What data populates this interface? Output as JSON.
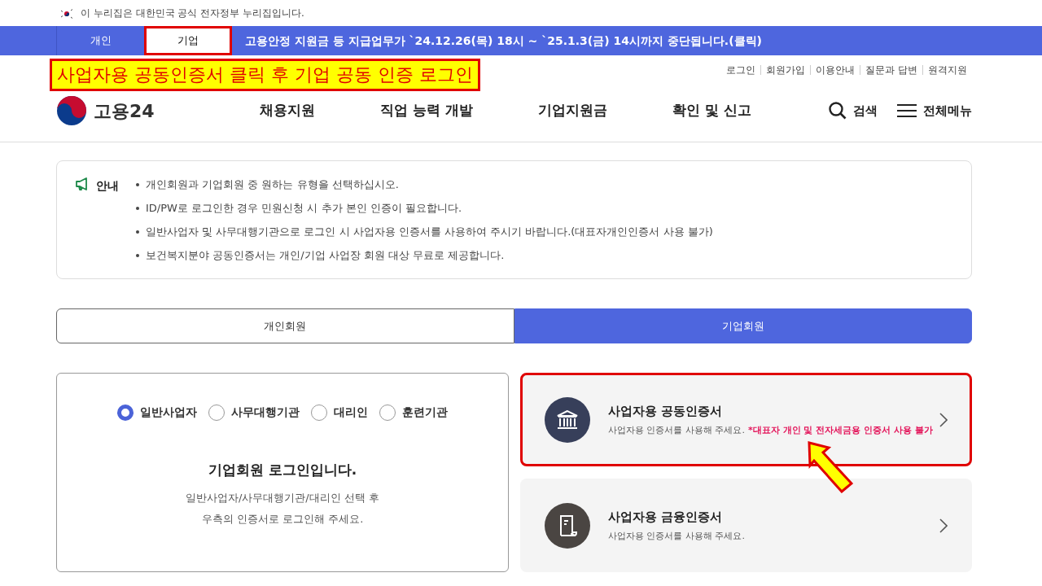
{
  "gov_banner": {
    "text": "이 누리집은 대한민국 공식 전자정부 누리집입니다."
  },
  "top_tabs": [
    {
      "label": "개인",
      "selected": false,
      "highlighted": false
    },
    {
      "label": "기업",
      "selected": true,
      "highlighted": true
    }
  ],
  "notice_ticker": "고용안정 지원금 등 지급업무가 `24.12.26(목) 18시 ~ `25.1.3(금) 14시까지 중단됩니다.(클릭)",
  "annotation": {
    "text": "사업자용 공동인증서 클릭 후 기업 공동 인증 로그인"
  },
  "utility_links": [
    "로그인",
    "회원가입",
    "이용안내",
    "질문과 답변",
    "원격지원"
  ],
  "logo": {
    "text": "고용24"
  },
  "main_nav": [
    "채용지원",
    "직업 능력 개발",
    "기업지원금",
    "확인 및 신고"
  ],
  "header_actions": [
    {
      "kind": "search",
      "label": "검색"
    },
    {
      "kind": "menu",
      "label": "전체메뉴"
    }
  ],
  "notice": {
    "title": "안내",
    "items": [
      "개인회원과 기업회원 중 원하는 유형을 선택하십시오.",
      "ID/PW로 로그인한 경우 민원신청 시 추가 본인 인증이 필요합니다.",
      "일반사업자 및 사무대행기관으로 로그인 시 사업자용 인증서를 사용하여 주시기 바랍니다.(대표자개인인증서 사용 불가)",
      "보건복지분야 공동인증서는 개인/기업 사업장 회원 대상 무료로 제공합니다."
    ]
  },
  "member_tabs": [
    {
      "label": "개인회원",
      "selected": false
    },
    {
      "label": "기업회원",
      "selected": true
    }
  ],
  "login_panel": {
    "radios": [
      {
        "label": "일반사업자",
        "selected": true
      },
      {
        "label": "사무대행기관",
        "selected": false
      },
      {
        "label": "대리인",
        "selected": false
      },
      {
        "label": "훈련기관",
        "selected": false
      }
    ],
    "heading": "기업회원 로그인입니다.",
    "description_lines": [
      "일반사업자/사무대행기관/대리인 선택 후",
      "우측의 인증서로 로그인해 주세요."
    ]
  },
  "certificates": [
    {
      "kind": "joint",
      "title": "사업자용 공동인증서",
      "description": "사업자용 인증서를 사용해 주세요.",
      "warning": "*대표자 개인 및 전자세금용 인증서 사용 불가",
      "highlighted": true
    },
    {
      "kind": "financial",
      "title": "사업자용 금융인증서",
      "description": "사업자용 인증서를 사용해 주세요.",
      "highlighted": false
    }
  ]
}
